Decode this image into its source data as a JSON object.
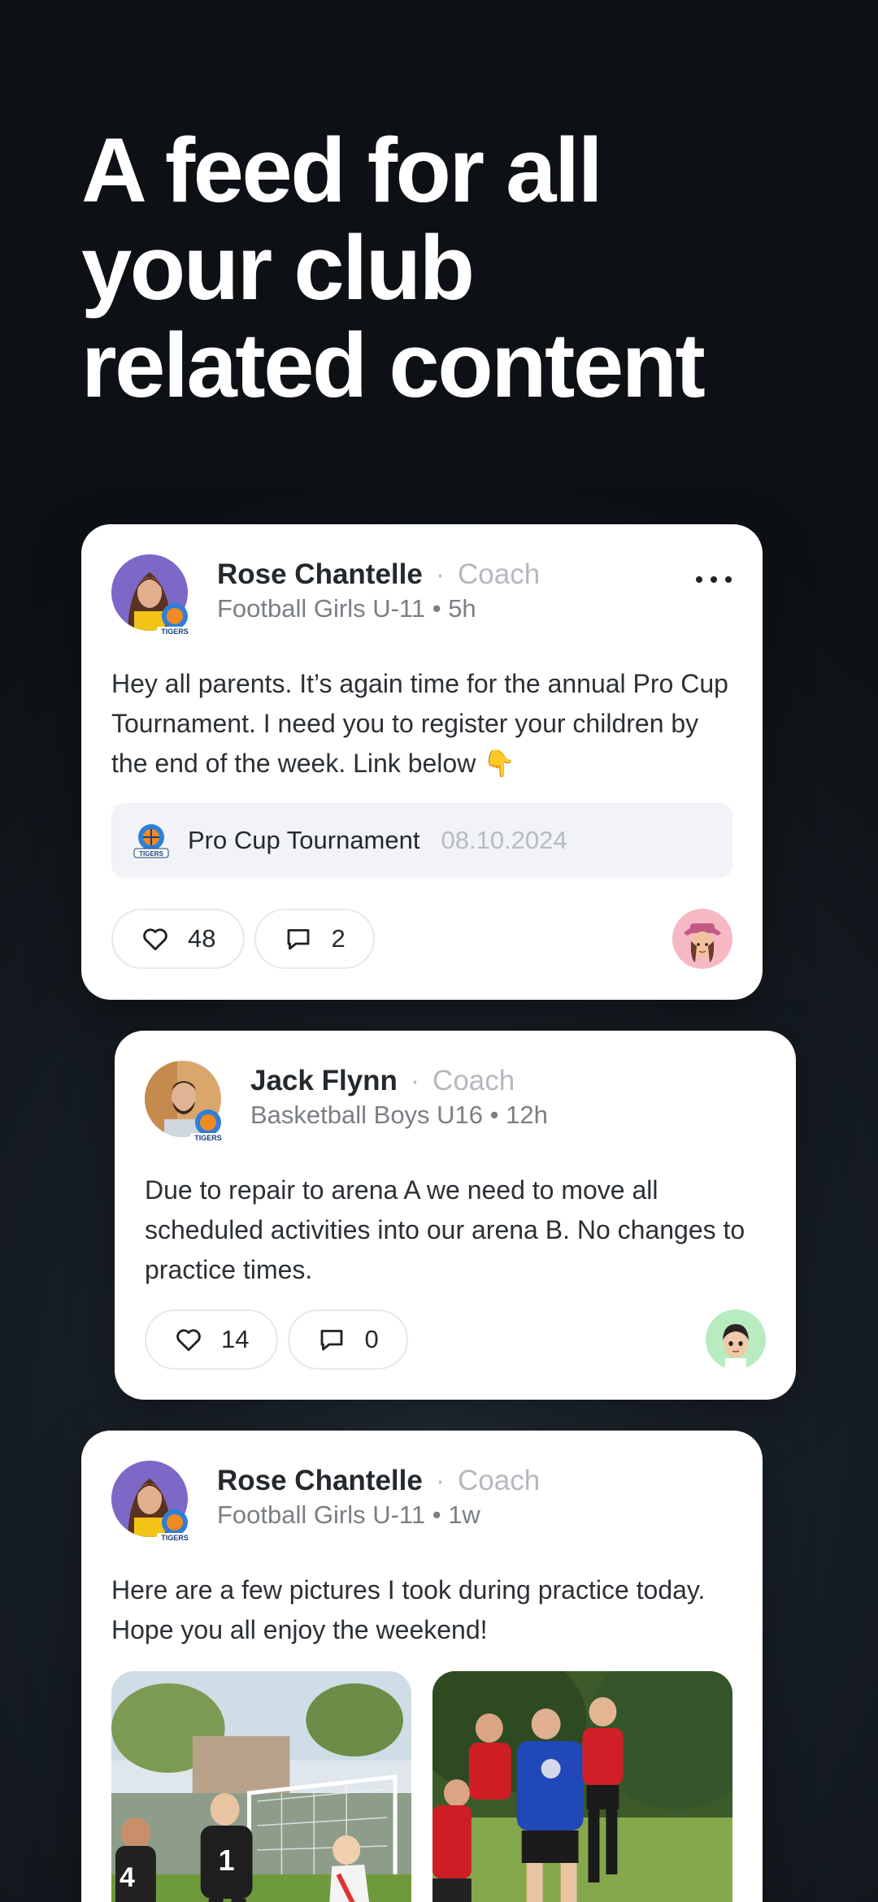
{
  "headline": {
    "line1": "A feed for all",
    "line2": "your club",
    "line3": "related content"
  },
  "posts": [
    {
      "author": "Rose Chantelle",
      "separator": "·",
      "role": "Coach",
      "meta": "Football Girls U-11 • 5h",
      "text": "Hey all parents. It’s again time for the annual Pro Cup Tournament. I need you to register your children by the end of the week. Link below 👇",
      "link": {
        "title": "Pro Cup Tournament",
        "date": "08.10.2024"
      },
      "likes": "48",
      "comments": "2"
    },
    {
      "author": "Jack Flynn",
      "separator": "·",
      "role": "Coach",
      "meta": "Basketball Boys U16 • 12h",
      "text": "Due to repair to arena A we need to move all scheduled activities into our arena B. No changes to practice times.",
      "likes": "14",
      "comments": "0"
    },
    {
      "author": "Rose Chantelle",
      "separator": "·",
      "role": "Coach",
      "meta": "Football Girls U-11 • 1w",
      "text": "Here are a few pictures I took during practice today. Hope you all enjoy the weekend!",
      "jersey_left_1": "4",
      "jersey_left_2": "1"
    }
  ],
  "club_badge_text": "TIGERS",
  "colors": {
    "background": "#141b21",
    "card": "#ffffff",
    "avatar_purple": "#7d68c8",
    "reactor_pink": "#f6b9c4",
    "reactor_green": "#b8ebbf"
  }
}
